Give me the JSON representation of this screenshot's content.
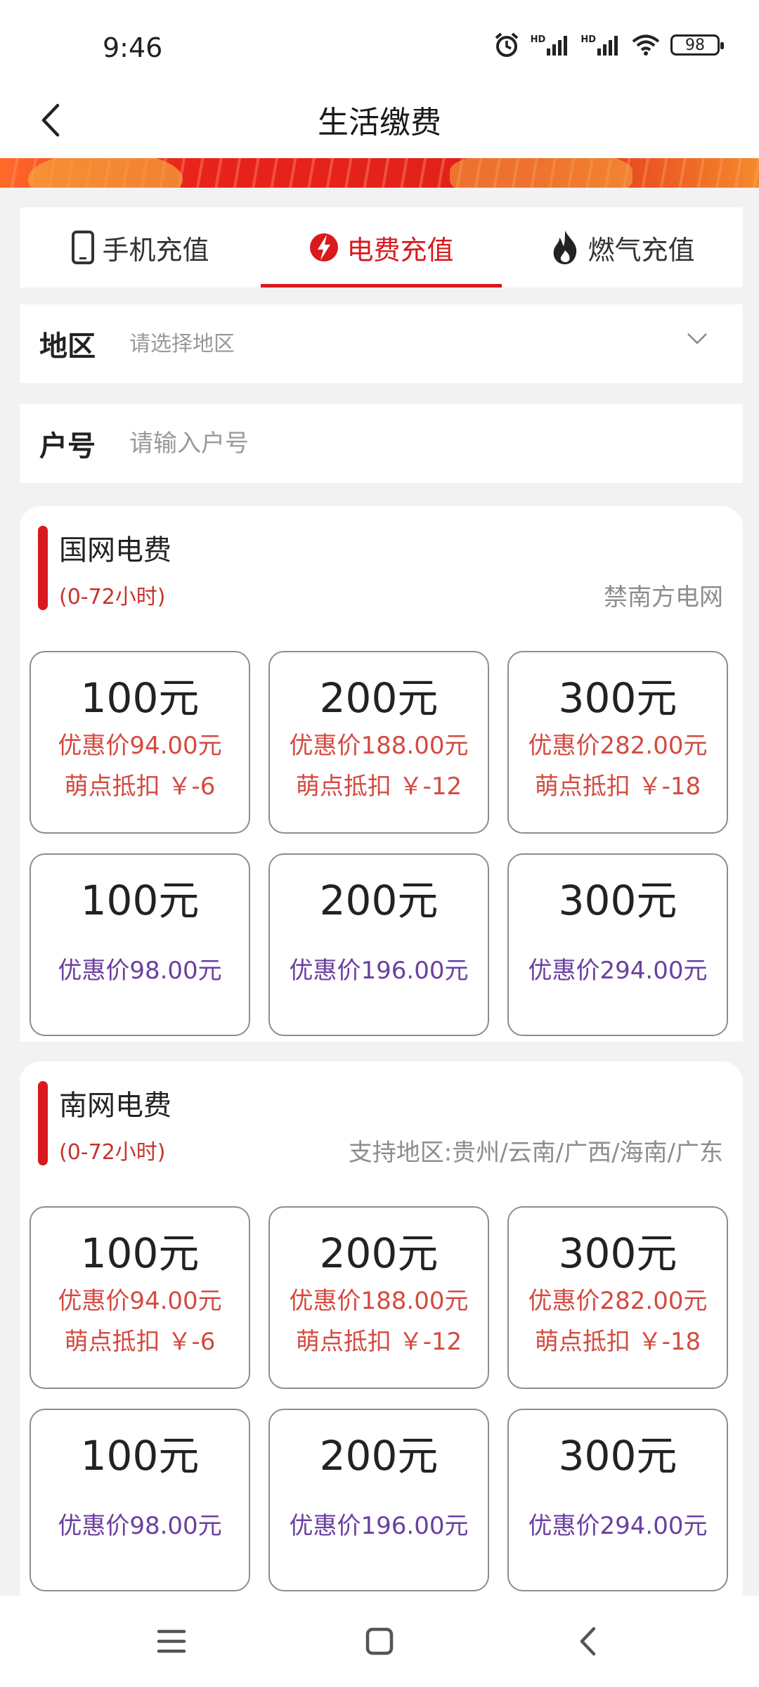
{
  "status": {
    "time": "9:46",
    "battery": "98",
    "signal1": "HD",
    "signal2": "HD"
  },
  "header": {
    "title": "生活缴费"
  },
  "tabs": [
    {
      "label": "手机充值",
      "icon": "phone-icon"
    },
    {
      "label": "电费充值",
      "icon": "lightning-icon",
      "active": true
    },
    {
      "label": "燃气充值",
      "icon": "flame-icon"
    }
  ],
  "form": {
    "region": {
      "label": "地区",
      "placeholder": "请选择地区"
    },
    "account": {
      "label": "户号",
      "placeholder": "请输入户号"
    }
  },
  "sections": [
    {
      "title": "国网电费",
      "subtitle": "(0-72小时)",
      "note": "禁南方电网",
      "items": [
        {
          "amount": "100元",
          "promo": "优惠价94.00元",
          "deduct": "萌点抵扣 ￥-6"
        },
        {
          "amount": "200元",
          "promo": "优惠价188.00元",
          "deduct": "萌点抵扣 ￥-12"
        },
        {
          "amount": "300元",
          "promo": "优惠价282.00元",
          "deduct": "萌点抵扣 ￥-18"
        },
        {
          "amount": "100元",
          "promo": "优惠价98.00元"
        },
        {
          "amount": "200元",
          "promo": "优惠价196.00元"
        },
        {
          "amount": "300元",
          "promo": "优惠价294.00元"
        }
      ]
    },
    {
      "title": "南网电费",
      "subtitle": "(0-72小时)",
      "note": "支持地区:贵州/云南/广西/海南/广东",
      "items": [
        {
          "amount": "100元",
          "promo": "优惠价94.00元",
          "deduct": "萌点抵扣 ￥-6"
        },
        {
          "amount": "200元",
          "promo": "优惠价188.00元",
          "deduct": "萌点抵扣 ￥-12"
        },
        {
          "amount": "300元",
          "promo": "优惠价282.00元",
          "deduct": "萌点抵扣 ￥-18"
        },
        {
          "amount": "100元",
          "promo": "优惠价98.00元"
        },
        {
          "amount": "200元",
          "promo": "优惠价196.00元"
        },
        {
          "amount": "300元",
          "promo": "优惠价294.00元"
        }
      ]
    }
  ],
  "colors": {
    "accent": "#d8191e",
    "promo_red": "#d44a40",
    "promo_purple": "#6b3fa0"
  }
}
